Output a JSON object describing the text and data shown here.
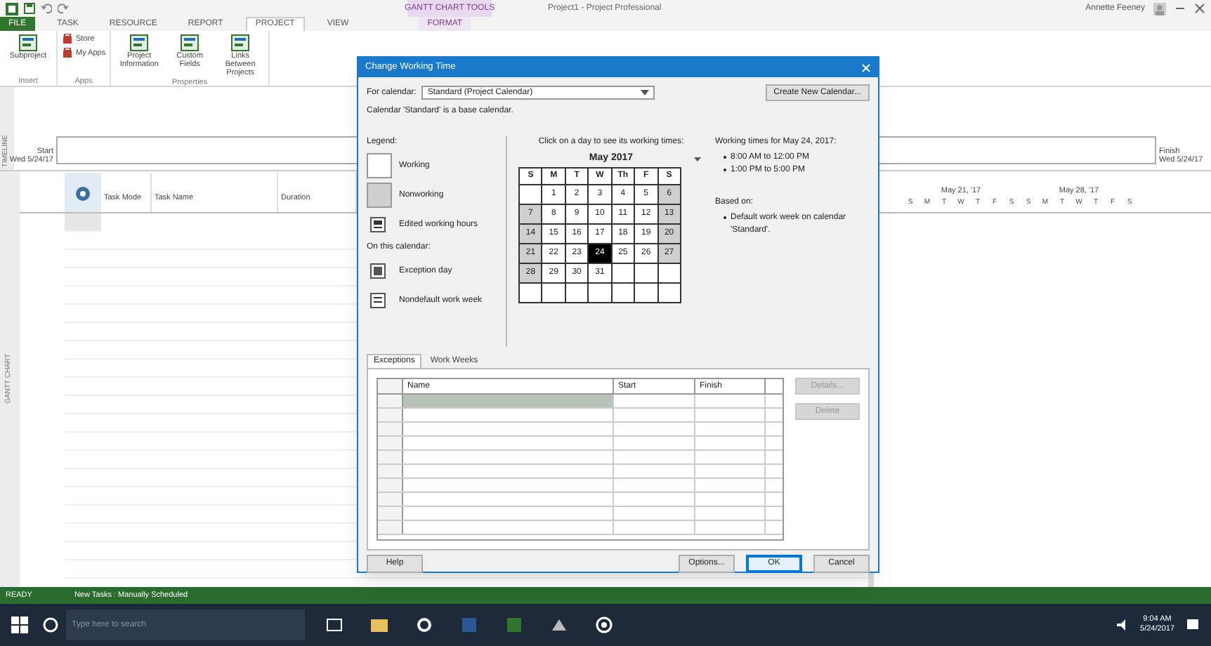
{
  "window": {
    "title": "Project1 - Project Professional",
    "contextual_tab": "GANTT CHART TOOLS",
    "user": "Annette Feeney"
  },
  "ribbon_tabs": [
    {
      "label": "FILE",
      "kind": "file",
      "selected": false
    },
    {
      "label": "TASK",
      "kind": "tab",
      "selected": false
    },
    {
      "label": "RESOURCE",
      "kind": "tab",
      "selected": false
    },
    {
      "label": "REPORT",
      "kind": "tab",
      "selected": false
    },
    {
      "label": "PROJECT",
      "kind": "tab",
      "selected": true
    },
    {
      "label": "VIEW",
      "kind": "tab",
      "selected": false
    },
    {
      "label": "FORMAT",
      "kind": "contextual",
      "selected": false
    }
  ],
  "ribbon_groups": [
    {
      "label": "Insert",
      "buttons": [
        {
          "label": "Subproject",
          "kind": "large"
        }
      ]
    },
    {
      "label": "Apps",
      "buttons": [
        {
          "label": "Store",
          "kind": "small"
        },
        {
          "label": "My Apps",
          "kind": "small"
        }
      ]
    },
    {
      "label": "Properties",
      "buttons": [
        {
          "label": "Project Information",
          "kind": "large"
        },
        {
          "label": "Custom Fields",
          "kind": "large"
        },
        {
          "label": "Links Between Projects",
          "kind": "large"
        }
      ]
    }
  ],
  "timeline": {
    "side_label": "TIMELINE",
    "start_label": "Start",
    "start_date": "Wed 5/24/17",
    "finish_label": "Finish",
    "finish_date": "Wed 5/24/17"
  },
  "gantt": {
    "side_label": "GANTT CHART",
    "columns": [
      {
        "label": "Task Mode"
      },
      {
        "label": "Task Name"
      },
      {
        "label": "Duration"
      }
    ],
    "weeks": [
      {
        "label": "May 21, '17",
        "days": [
          "S",
          "M",
          "T",
          "W",
          "T",
          "F",
          "S"
        ]
      },
      {
        "label": "May 28, '17",
        "days": [
          "S",
          "M",
          "T",
          "W",
          "T",
          "F",
          "S"
        ]
      }
    ]
  },
  "dialog": {
    "title": "Change Working Time",
    "calendar_label": "For calendar:",
    "calendar_value": "Standard (Project Calendar)",
    "new_calendar_button": "Create New Calendar...",
    "base_note": "Calendar 'Standard' is a base calendar.",
    "legend_title": "Legend:",
    "legend": [
      {
        "label": "Working",
        "kind": "working"
      },
      {
        "label": "Nonworking",
        "kind": "nonworking"
      },
      {
        "label": "Edited working hours",
        "kind": "edited"
      }
    ],
    "on_calendar_title": "On this calendar:",
    "on_calendar": [
      {
        "label": "Exception day",
        "kind": "exception"
      },
      {
        "label": "Nondefault work week",
        "kind": "nondefault"
      }
    ],
    "click_hint": "Click on a day to see its working times:",
    "month": "May 2017",
    "weekdays": [
      "S",
      "M",
      "T",
      "W",
      "Th",
      "F",
      "S"
    ],
    "weeks": [
      [
        {
          "kind": "blank"
        },
        {
          "day": "1",
          "kind": "working",
          "selected": false
        },
        {
          "day": "2",
          "kind": "working",
          "selected": false
        },
        {
          "day": "3",
          "kind": "working",
          "selected": false
        },
        {
          "day": "4",
          "kind": "working",
          "selected": false
        },
        {
          "day": "5",
          "kind": "working",
          "selected": false
        },
        {
          "day": "6",
          "kind": "nonworking",
          "selected": false
        }
      ],
      [
        {
          "day": "7",
          "kind": "nonworking",
          "selected": false
        },
        {
          "day": "8",
          "kind": "working",
          "selected": false
        },
        {
          "day": "9",
          "kind": "working",
          "selected": false
        },
        {
          "day": "10",
          "kind": "working",
          "selected": false
        },
        {
          "day": "11",
          "kind": "working",
          "selected": false
        },
        {
          "day": "12",
          "kind": "working",
          "selected": false
        },
        {
          "day": "13",
          "kind": "nonworking",
          "selected": false
        }
      ],
      [
        {
          "day": "14",
          "kind": "nonworking",
          "selected": false
        },
        {
          "day": "15",
          "kind": "working",
          "selected": false
        },
        {
          "day": "16",
          "kind": "working",
          "selected": false
        },
        {
          "day": "17",
          "kind": "working",
          "selected": false
        },
        {
          "day": "18",
          "kind": "working",
          "selected": false
        },
        {
          "day": "19",
          "kind": "working",
          "selected": false
        },
        {
          "day": "20",
          "kind": "nonworking",
          "selected": false
        }
      ],
      [
        {
          "day": "21",
          "kind": "nonworking",
          "selected": false
        },
        {
          "day": "22",
          "kind": "working",
          "selected": false
        },
        {
          "day": "23",
          "kind": "working",
          "selected": false
        },
        {
          "day": "24",
          "kind": "working",
          "selected": true
        },
        {
          "day": "25",
          "kind": "working",
          "selected": false
        },
        {
          "day": "26",
          "kind": "working",
          "selected": false
        },
        {
          "day": "27",
          "kind": "nonworking",
          "selected": false
        }
      ],
      [
        {
          "day": "28",
          "kind": "nonworking",
          "selected": false
        },
        {
          "day": "29",
          "kind": "working",
          "selected": false
        },
        {
          "day": "30",
          "kind": "working",
          "selected": false
        },
        {
          "day": "31",
          "kind": "working",
          "selected": false
        },
        {
          "kind": "blank"
        },
        {
          "kind": "blank"
        },
        {
          "kind": "blank"
        }
      ],
      [
        {
          "kind": "blank"
        },
        {
          "kind": "blank"
        },
        {
          "kind": "blank"
        },
        {
          "kind": "blank"
        },
        {
          "kind": "blank"
        },
        {
          "kind": "blank"
        },
        {
          "kind": "blank"
        }
      ]
    ],
    "working_times_title": "Working times for May 24, 2017:",
    "working_times": [
      "8:00 AM to 12:00 PM",
      "1:00 PM to 5:00 PM"
    ],
    "based_on_title": "Based on:",
    "based_on": "Default work week on calendar 'Standard'.",
    "tabs": [
      {
        "label": "Exceptions",
        "selected": true
      },
      {
        "label": "Work Weeks",
        "selected": false
      }
    ],
    "table_columns": [
      "Name",
      "Start",
      "Finish"
    ],
    "side_buttons": [
      {
        "label": "Details...",
        "disabled": true
      },
      {
        "label": "Delete",
        "disabled": true
      }
    ],
    "buttons": [
      {
        "label": "Help",
        "kind": "help"
      },
      {
        "label": "Options...",
        "kind": "normal"
      },
      {
        "label": "OK",
        "kind": "default"
      },
      {
        "label": "Cancel",
        "kind": "normal"
      }
    ]
  },
  "status_bar": {
    "mode": "READY",
    "message": "New Tasks : Manually Scheduled"
  },
  "taskbar": {
    "search_placeholder": "Type here to search",
    "time": "9:04 AM",
    "date": "5/24/2017"
  }
}
